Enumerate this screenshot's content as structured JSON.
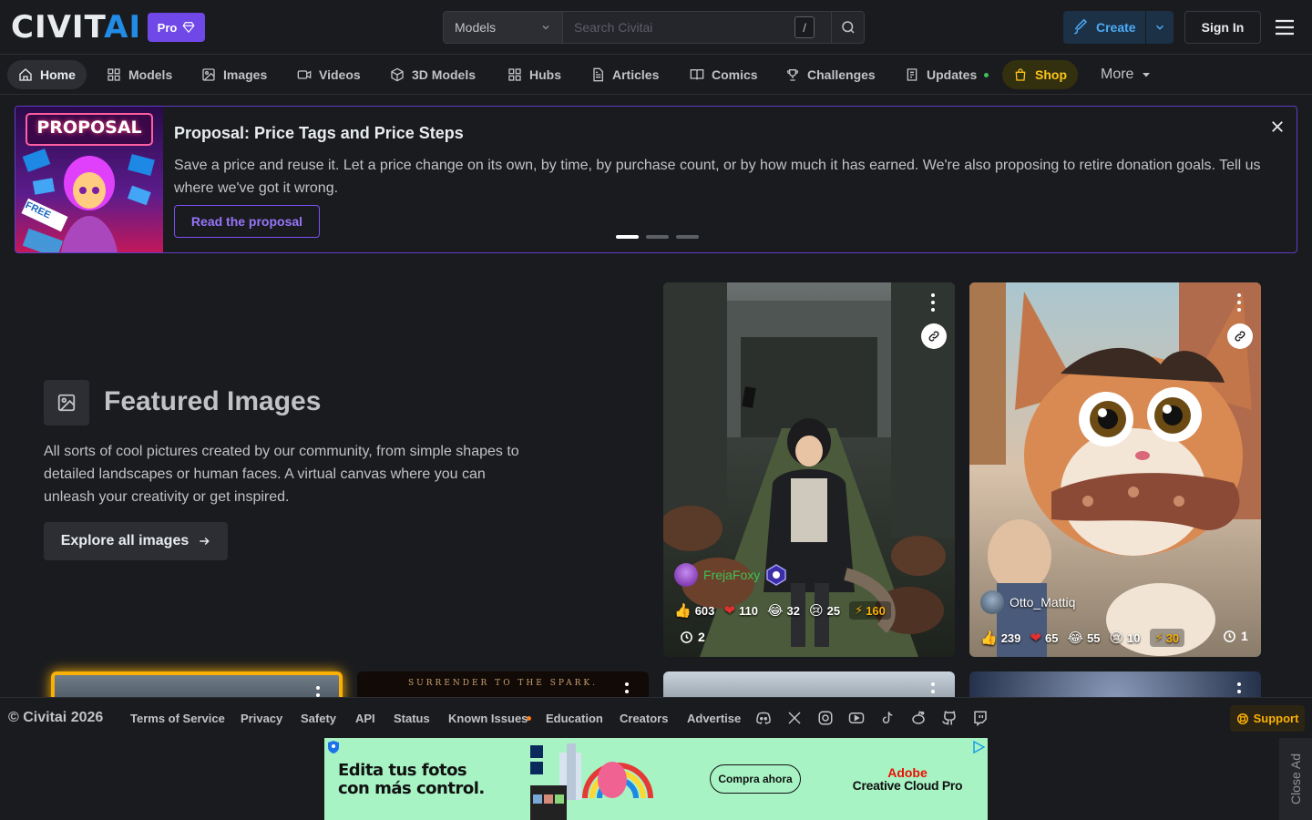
{
  "header": {
    "logo_main": "CIVIT",
    "logo_accent": "AI",
    "pro_label": "Pro",
    "search_scope": "Models",
    "search_placeholder": "Search Civitai",
    "search_shortcut": "/",
    "create_label": "Create",
    "signin_label": "Sign In"
  },
  "nav": {
    "items": [
      {
        "label": "Home"
      },
      {
        "label": "Models"
      },
      {
        "label": "Images"
      },
      {
        "label": "Videos"
      },
      {
        "label": "3D Models"
      },
      {
        "label": "Hubs"
      },
      {
        "label": "Articles"
      },
      {
        "label": "Comics"
      },
      {
        "label": "Challenges"
      },
      {
        "label": "Updates"
      },
      {
        "label": "Shop"
      }
    ],
    "more_label": "More"
  },
  "banner": {
    "image_label": "PROPOSAL",
    "image_tag": "FREE",
    "title": "Proposal: Price Tags and Price Steps",
    "text": "Save a price and reuse it. Let a price change on its own, by time, by purchase count, or by how much it has earned. We're also proposing to retire donation goals. Tell us where we've got it wrong.",
    "button_label": "Read the proposal"
  },
  "featured": {
    "title": "Featured Images",
    "description": "All sorts of cool pictures created by our community, from simple shapes to detailed landscapes or human faces. A virtual canvas where you can unleash your creativity or get inspired.",
    "explore_label": "Explore all images"
  },
  "cards": [
    {
      "username": "FrejaFoxy",
      "likes": "603",
      "hearts": "110",
      "laughs": "32",
      "cries": "25",
      "buzz": "160",
      "comments": "2"
    },
    {
      "username": "Otto_Mattiq",
      "likes": "239",
      "hearts": "65",
      "laughs": "55",
      "cries": "10",
      "buzz": "30",
      "comments": "1"
    },
    {
      "caption": "SURRENDER TO THE SPARK."
    }
  ],
  "footer": {
    "copyright": "© Civitai 2026",
    "links": [
      "Terms of Service",
      "Privacy",
      "Safety",
      "API",
      "Status",
      "Known Issues",
      "Education",
      "Creators",
      "Advertise"
    ],
    "support_label": "Support"
  },
  "ad": {
    "headline_1": "Edita tus fotos",
    "headline_2": "con más control.",
    "cta": "Compra ahora",
    "brand_1": "Adobe",
    "brand_2": "Creative Cloud Pro",
    "close_label": "Close Ad"
  },
  "colors": {
    "accent": "#228be6",
    "pro": "#7048e8",
    "shop": "#fcc419",
    "banner_border": "#5f3dc4",
    "buzz": "#fab005"
  }
}
